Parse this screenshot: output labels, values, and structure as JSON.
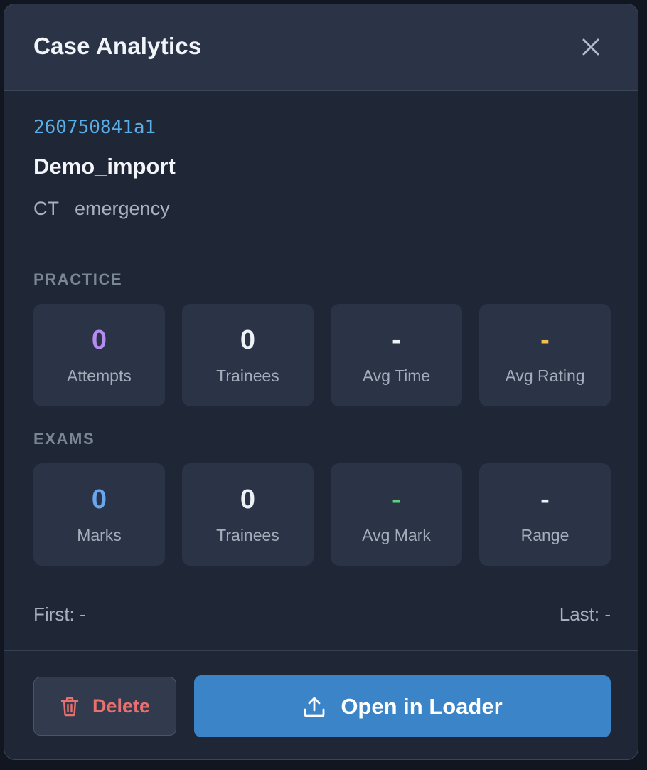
{
  "modal": {
    "title": "Case Analytics",
    "close_icon": "close-icon"
  },
  "case": {
    "id": "260750841a1",
    "name": "Demo_import",
    "tags": [
      "CT",
      "emergency"
    ]
  },
  "practice": {
    "label": "PRACTICE",
    "stats": [
      {
        "value": "0",
        "label": "Attempts",
        "color": "#b68cf0"
      },
      {
        "value": "0",
        "label": "Trainees",
        "color": "#eef1f5"
      },
      {
        "value": "-",
        "label": "Avg Time",
        "color": "#eef1f5"
      },
      {
        "value": "-",
        "label": "Avg Rating",
        "color": "#f0c24a"
      }
    ]
  },
  "exams": {
    "label": "EXAMS",
    "stats": [
      {
        "value": "0",
        "label": "Marks",
        "color": "#6aa6ee"
      },
      {
        "value": "0",
        "label": "Trainees",
        "color": "#eef1f5"
      },
      {
        "value": "-",
        "label": "Avg Mark",
        "color": "#5fcf7e"
      },
      {
        "value": "-",
        "label": "Range",
        "color": "#eef1f5"
      }
    ]
  },
  "dates": {
    "first": "First: -",
    "last": "Last: -"
  },
  "footer": {
    "delete_label": "Delete",
    "delete_icon": "trash-icon",
    "open_label": "Open in Loader",
    "open_icon": "upload-icon"
  },
  "colors": {
    "accent": "#3a84c7",
    "danger": "#e8706e",
    "case_id": "#5aaee8"
  }
}
